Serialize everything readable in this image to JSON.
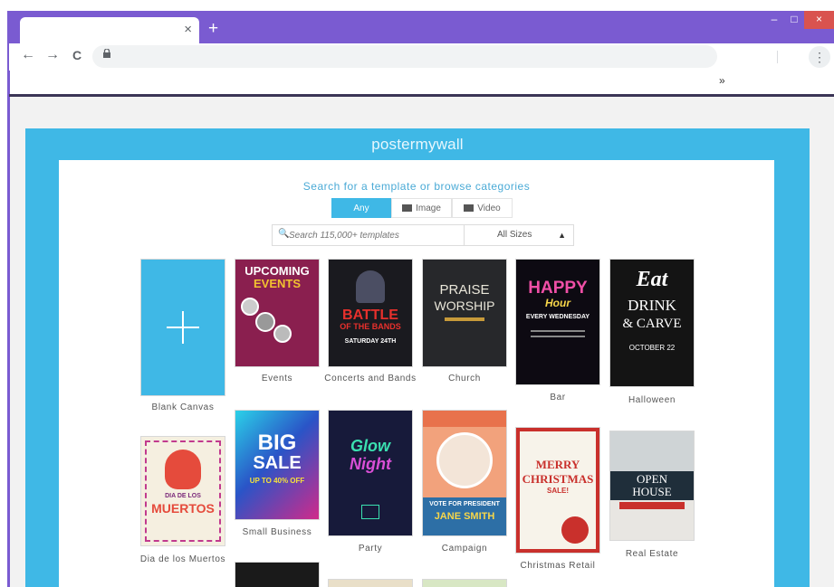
{
  "browser": {
    "tab_close": "×",
    "new_tab": "+",
    "minimize": "–",
    "maximize": "□",
    "close": "×",
    "back": "←",
    "forward": "→",
    "reload": "C",
    "menu": "⋮",
    "bookmarks_more": "»"
  },
  "app": {
    "brand": "postermywall",
    "heading": "Search for a template or browse categories",
    "filters": [
      "Any",
      "Image",
      "Video"
    ],
    "search": {
      "placeholder": "Search 115,000+ templates"
    },
    "sizes": {
      "value": "All Sizes"
    }
  },
  "categories": [
    {
      "label": "Blank Canvas"
    },
    {
      "label": "Events",
      "poster": [
        "UPCOMING",
        "EVENTS"
      ]
    },
    {
      "label": "Concerts and Bands",
      "poster": [
        "BATTLE",
        "OF THE BANDS",
        "SATURDAY 24TH"
      ]
    },
    {
      "label": "Church",
      "poster": [
        "PRAISE",
        "WORSHIP"
      ]
    },
    {
      "label": "Bar",
      "poster": [
        "HAPPY",
        "Hour",
        "EVERY WEDNESDAY"
      ]
    },
    {
      "label": "Halloween",
      "poster": [
        "Eat",
        "DRINK",
        "& CARVE",
        "OCTOBER 22"
      ]
    },
    {
      "label": "Dia de los Muertos",
      "poster": [
        "DIA DE LOS",
        "MUERTOS"
      ]
    },
    {
      "label": "Small Business",
      "poster": [
        "BIG",
        "SALE",
        "UP TO 40% OFF"
      ]
    },
    {
      "label": "Party",
      "poster": [
        "Glow",
        "Night"
      ]
    },
    {
      "label": "Campaign",
      "poster": [
        "VOTE",
        "FOR PRESIDENT",
        "JANE SMITH"
      ]
    },
    {
      "label": "Christmas Retail",
      "poster": [
        "MERRY",
        "CHRISTMAS",
        "SALE!"
      ]
    },
    {
      "label": "Real Estate",
      "poster": [
        "OPEN",
        "HOUSE"
      ]
    }
  ],
  "colors": {
    "browser_frame": "#7a5bd1",
    "brand_blue": "#3fb8e6",
    "close_red": "#d9534f"
  }
}
